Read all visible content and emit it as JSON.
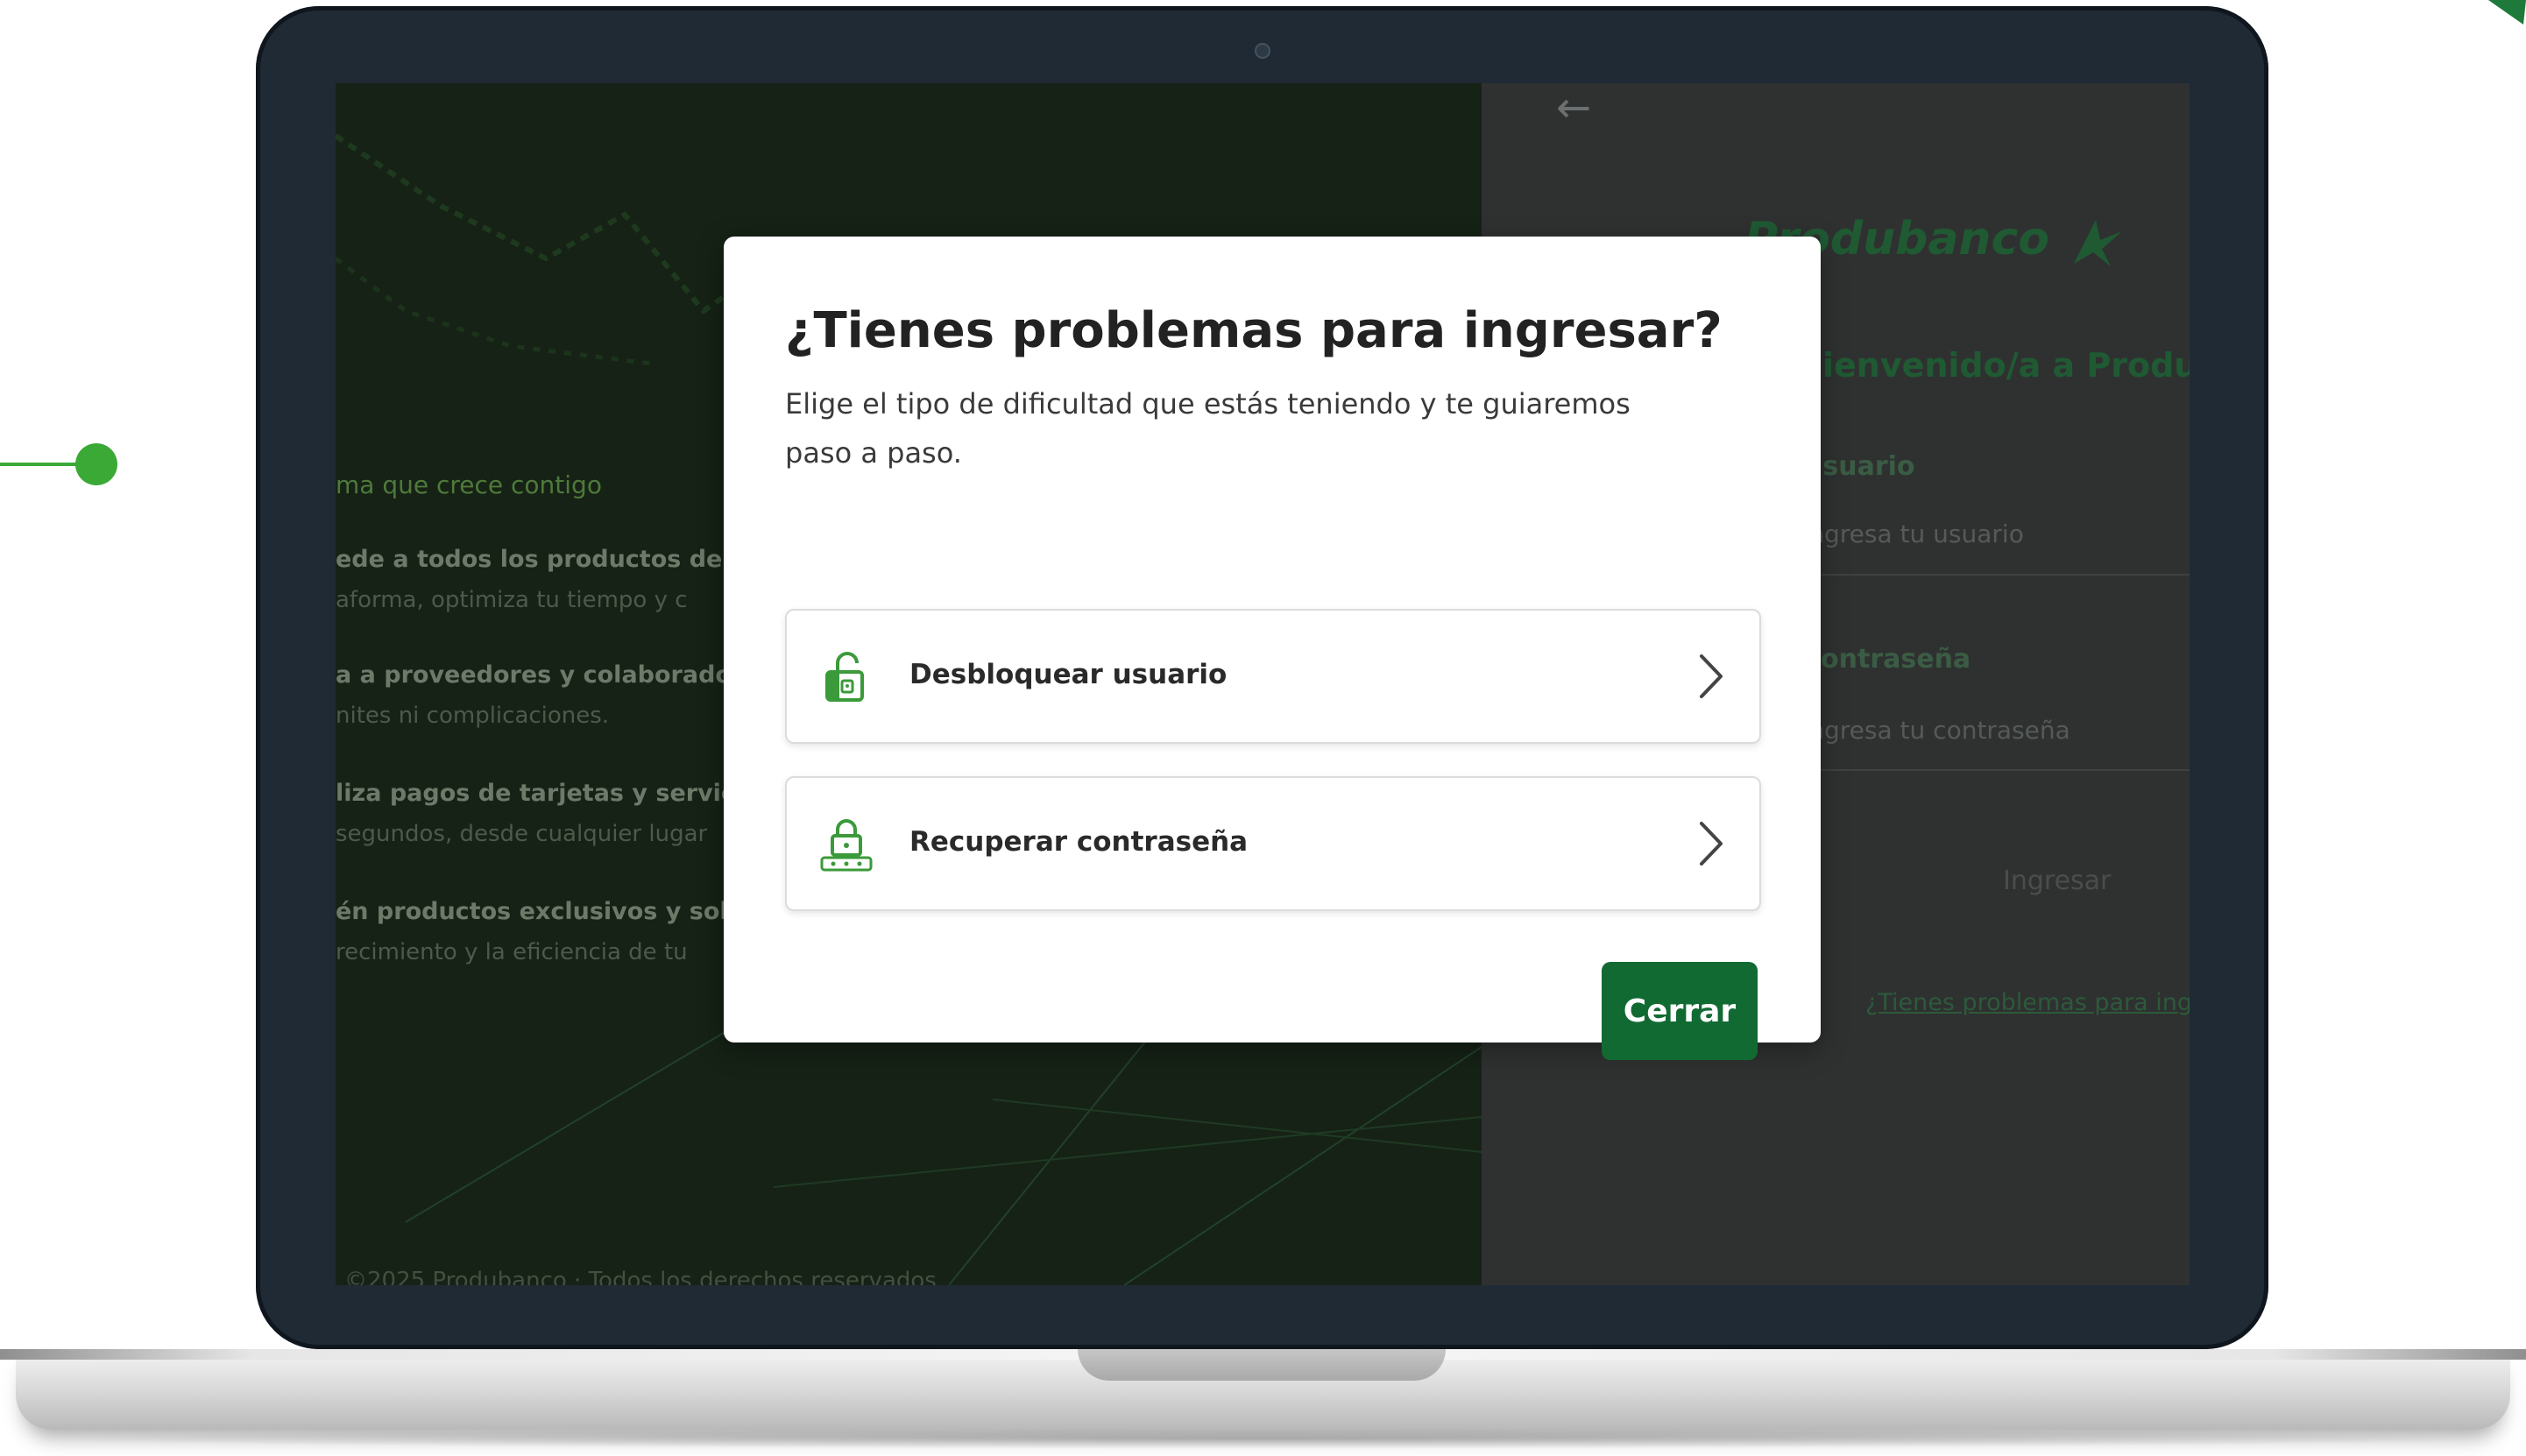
{
  "left_panel": {
    "tagline": "ma que crece contigo",
    "bullets": [
      {
        "title": "ede a todos los productos de",
        "text": "aforma, optimiza tu tiempo y c"
      },
      {
        "title": "a a proveedores y colaborado",
        "text": "nites ni complicaciones."
      },
      {
        "title": "liza pagos de tarjetas y servic",
        "text": "segundos, desde cualquier lugar"
      },
      {
        "title": "én productos exclusivos y sol",
        "text": "recimiento y la eficiencia de tu"
      }
    ],
    "footer": "©2025 Produbanco · Todos los derechos reservados"
  },
  "right_panel": {
    "back_icon": "←",
    "logo_text": "Produbanco",
    "welcome_title": "Bienvenido/a a Produbanco Emp",
    "user_label": "Usuario",
    "user_placeholder": "Ingresa tu usuario",
    "password_label": "Contraseña",
    "password_placeholder": "Ingresa tu contraseña",
    "login_button": "Ingresar",
    "trouble_link": "¿Tienes problemas para ingresar?"
  },
  "modal": {
    "title": "¿Tienes problemas para ingresar?",
    "description": "Elige el tipo de dificultad que estás teniendo y te guiaremos paso a paso.",
    "options": [
      {
        "label": "Desbloquear usuario",
        "icon": "unlock-icon"
      },
      {
        "label": "Recuperar contraseña",
        "icon": "password-lock-icon"
      }
    ],
    "close_button": "Cerrar"
  },
  "colors": {
    "accent_green": "#126a33",
    "icon_green": "#3b9a3a",
    "bezel": "#1f2a35",
    "decoration_green": "#3aa935"
  }
}
